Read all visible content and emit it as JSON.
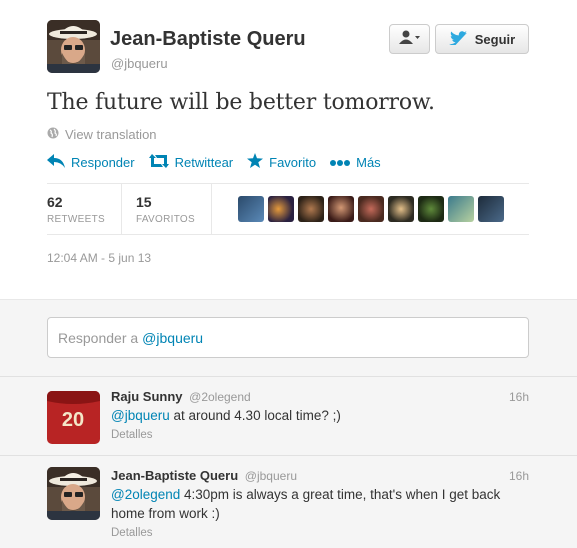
{
  "tweet": {
    "fullname": "Jean-Baptiste Queru",
    "username": "@jbqueru",
    "follow_label": "Seguir",
    "text": "The future will be better tomorrow.",
    "view_translation": "View translation",
    "actions": {
      "reply": "Responder",
      "retweet": "Retwittear",
      "favorite": "Favorito",
      "more": "Más"
    },
    "stats": {
      "retweets_count": "62",
      "retweets_label": "RETWEETS",
      "favorites_count": "15",
      "favorites_label": "FAVORITOS"
    },
    "timestamp": "12:04 AM - 5 jun 13"
  },
  "reply_box": {
    "prefix": "Responder a",
    "mention": "@jbqueru"
  },
  "replies": [
    {
      "fullname": "Raju Sunny",
      "username": "@2olegend",
      "time": "16h",
      "mention": "@jbqueru",
      "text": " at around 4.30 local time? ;)",
      "details": "Detalles"
    },
    {
      "fullname": "Jean-Baptiste Queru",
      "username": "@jbqueru",
      "time": "16h",
      "mention": "@2olegend",
      "text": " 4:30pm is always a great time, that's when I get back home from work :)",
      "details": "Detalles"
    }
  ],
  "avatar_jersey_number": "20",
  "colors": {
    "link": "#0084b4",
    "twitter_blue": "#2ea9df",
    "muted": "#999999"
  },
  "icons": [
    "user-icon",
    "twitter-bird-icon",
    "globe-icon",
    "reply-icon",
    "retweet-icon",
    "star-icon",
    "more-dots-icon"
  ]
}
